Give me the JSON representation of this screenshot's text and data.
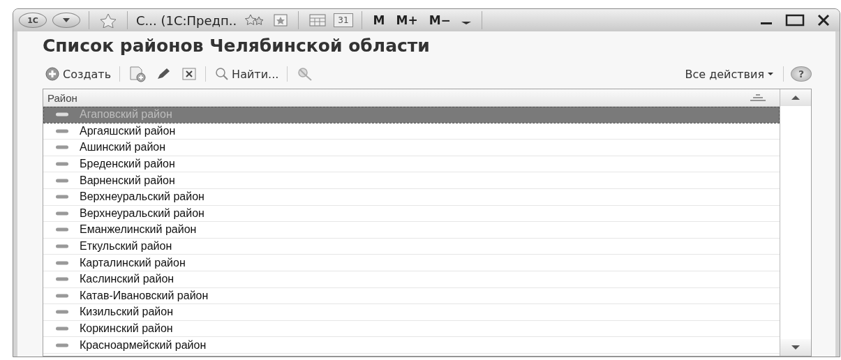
{
  "window": {
    "logo": "1С",
    "title": "С...  (1С:Предп..",
    "calendar_day": "31",
    "memory_buttons": [
      "M",
      "M+",
      "M−"
    ]
  },
  "heading": "Список районов Челябинской области",
  "toolbar": {
    "create": "Создать",
    "find": "Найти...",
    "all_actions": "Все действия",
    "help": "?"
  },
  "table": {
    "columns": [
      "Район"
    ],
    "rows": [
      {
        "name": "Агаповский район",
        "selected": true
      },
      {
        "name": "Аргаяшский район",
        "selected": false
      },
      {
        "name": "Ашинский район",
        "selected": false
      },
      {
        "name": "Бреденский район",
        "selected": false
      },
      {
        "name": "Варненский район",
        "selected": false
      },
      {
        "name": "Верхнеуральский район",
        "selected": false
      },
      {
        "name": "Верхнеуральский район",
        "selected": false
      },
      {
        "name": "Еманжелинский район",
        "selected": false
      },
      {
        "name": "Еткульский район",
        "selected": false
      },
      {
        "name": "Карталинский район",
        "selected": false
      },
      {
        "name": "Каслинский район",
        "selected": false
      },
      {
        "name": "Катав-Ивановский район",
        "selected": false
      },
      {
        "name": "Кизильский район",
        "selected": false
      },
      {
        "name": "Коркинский район",
        "selected": false
      },
      {
        "name": "Красноармейский район",
        "selected": false
      }
    ]
  }
}
